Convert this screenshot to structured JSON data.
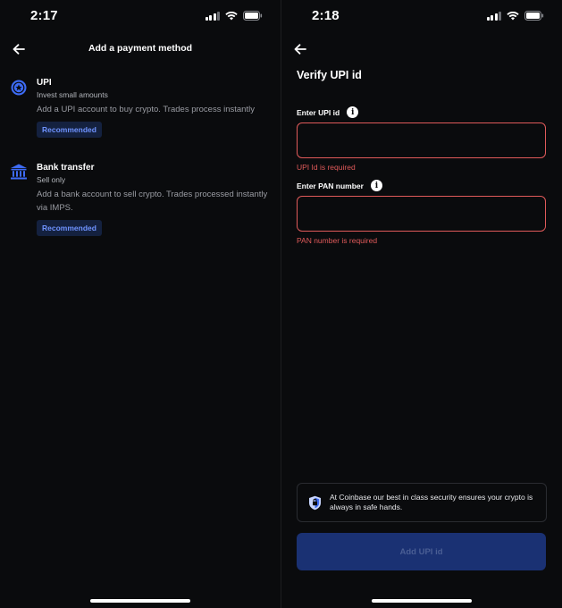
{
  "left_screen": {
    "status": {
      "time": "2:17"
    },
    "header": {
      "title": "Add a payment method"
    },
    "methods": [
      {
        "icon": "upi-star-icon",
        "title": "UPI",
        "subtitle": "Invest small amounts",
        "description": "Add a UPI account to buy crypto. Trades process instantly",
        "badge": "Recommended"
      },
      {
        "icon": "bank-icon",
        "title": "Bank transfer",
        "subtitle": "Sell only",
        "description": "Add a bank account to sell crypto. Trades processed instantly via IMPS.",
        "badge": "Recommended"
      }
    ]
  },
  "right_screen": {
    "status": {
      "time": "2:18"
    },
    "title": "Verify UPI id",
    "fields": [
      {
        "label": "Enter UPI id",
        "value": "",
        "error": "UPI Id is required"
      },
      {
        "label": "Enter PAN number",
        "value": "",
        "error": "PAN number is required"
      }
    ],
    "security_note": "At Coinbase our best in class security ensures your crypto is always in safe hands.",
    "submit_label": "Add UPI id"
  },
  "colors": {
    "background": "#0a0b0d",
    "error": "#e05a5a",
    "badge_bg": "#14213f",
    "badge_text": "#6f93ff",
    "button_disabled": "#1a3173"
  }
}
